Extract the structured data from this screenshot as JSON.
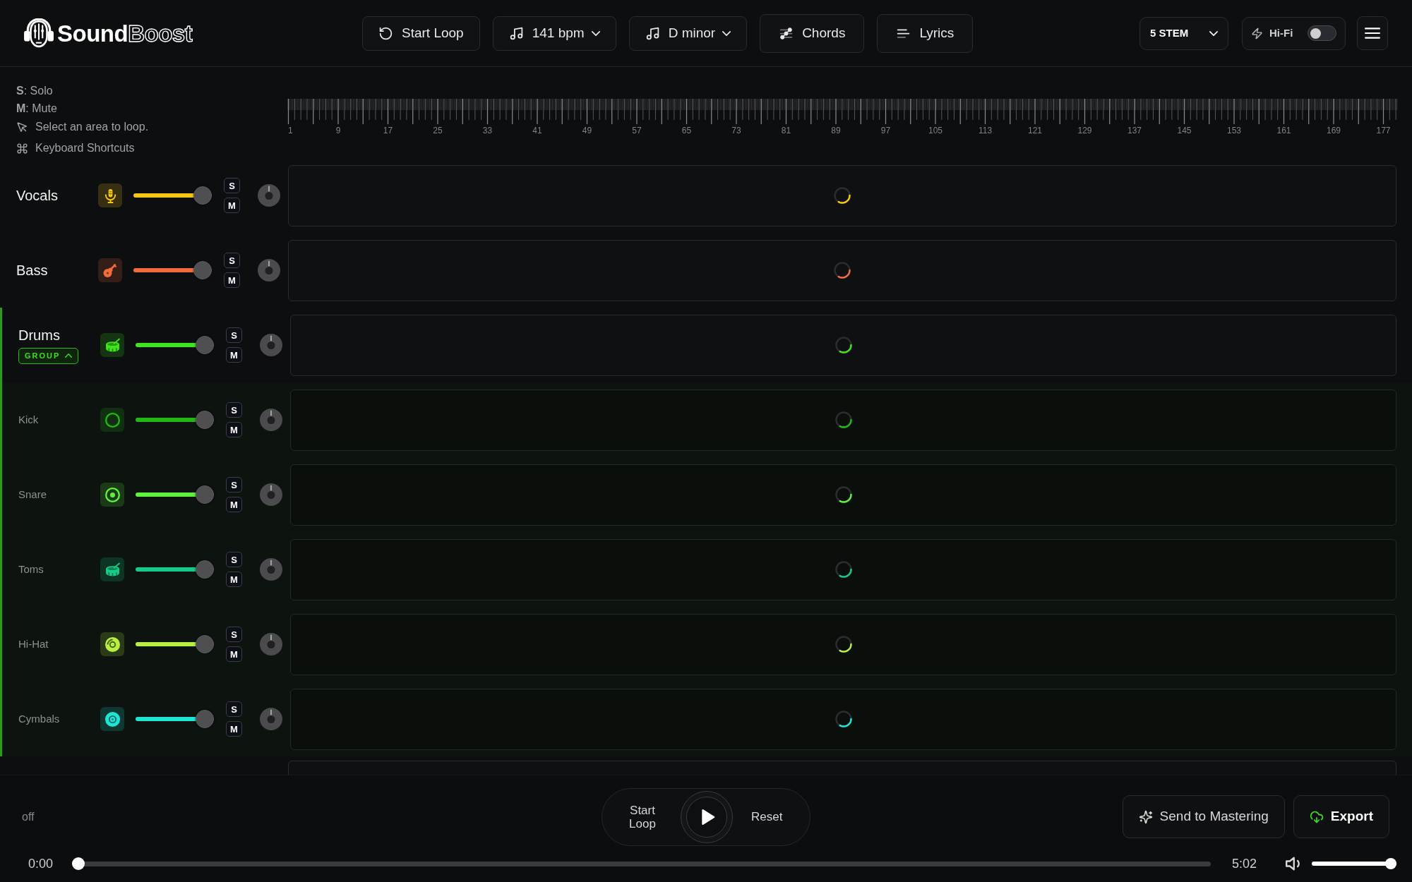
{
  "header": {
    "logo": {
      "filled": "Sound",
      "outlined": "Boost"
    },
    "toolbar": [
      {
        "kind": "action",
        "label": "Start Loop"
      },
      {
        "kind": "dropdown",
        "label": "141 bpm"
      },
      {
        "kind": "dropdown",
        "label": "D minor"
      },
      {
        "kind": "tool",
        "label": "Chords"
      },
      {
        "kind": "tool",
        "label": "Lyrics"
      }
    ],
    "stem_select": {
      "label": "5 STEM"
    },
    "hifi": {
      "label": "Hi-Fi",
      "on": false
    }
  },
  "legend": [
    {
      "kind": "key",
      "text": "**S**: Solo"
    },
    {
      "kind": "key",
      "text": "**M**: Mute"
    },
    {
      "kind": "hint",
      "text": "Select an area to loop."
    },
    {
      "kind": "link",
      "text": "Keyboard Shortcuts"
    }
  ],
  "ruler": {
    "labels": [
      "1",
      "9",
      "17",
      "25",
      "33",
      "41",
      "49",
      "57",
      "65",
      "73",
      "81",
      "89",
      "97",
      "105",
      "113",
      "121",
      "129",
      "137",
      "145",
      "153",
      "161",
      "169",
      "177"
    ]
  },
  "tracks": [
    {
      "name": "Vocals",
      "color": "#f7c514",
      "level": 1,
      "solo_label": "S",
      "mute_label": "M",
      "loading": true
    },
    {
      "name": "Bass",
      "color": "#f26b3b",
      "level": 1,
      "solo_label": "S",
      "mute_label": "M",
      "loading": true
    },
    {
      "name": "Drums",
      "badge": "GROUP",
      "expanded": true,
      "color": "#3fe51c",
      "level": 1,
      "solo_label": "S",
      "mute_label": "M",
      "loading": true,
      "children": [
        {
          "name": "Kick",
          "color": "#22b814",
          "level": 1,
          "solo_label": "S",
          "mute_label": "M",
          "loading": true
        },
        {
          "name": "Snare",
          "color": "#5ff23c",
          "level": 1,
          "solo_label": "S",
          "mute_label": "M",
          "loading": true
        },
        {
          "name": "Toms",
          "color": "#14cc87",
          "level": 1,
          "solo_label": "S",
          "mute_label": "M",
          "loading": true
        },
        {
          "name": "Hi-Hat",
          "color": "#b8f03f",
          "level": 1,
          "solo_label": "S",
          "mute_label": "M",
          "loading": true
        },
        {
          "name": "Cymbals",
          "color": "#1de6d6",
          "level": 1,
          "solo_label": "S",
          "mute_label": "M",
          "loading": true
        }
      ]
    }
  ],
  "more_tracks_below": true,
  "footer": {
    "loop_status": "off",
    "transport": {
      "loop_label": "Start Loop",
      "playing": false,
      "reset_label": "Reset"
    },
    "actions": [
      {
        "kind": "secondary",
        "label": "Send to Mastering"
      },
      {
        "kind": "primary",
        "label": "Export"
      }
    ],
    "elapsed": "0:00",
    "progress": {
      "level": 0
    },
    "duration": "5:02",
    "volume": {
      "level": 1
    }
  }
}
